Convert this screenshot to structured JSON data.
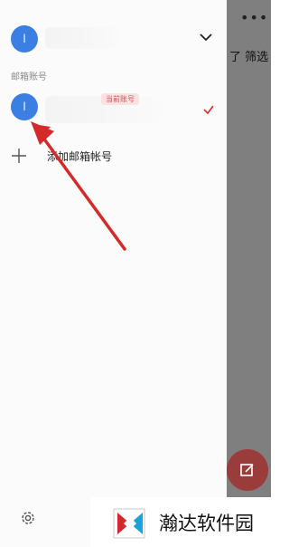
{
  "background_app": {
    "more_glyph": "•••",
    "filter_label": "筛选",
    "filter_icon_glyph": "了"
  },
  "drawer": {
    "current_account": {
      "avatar_letter": "l"
    },
    "section_label": "邮箱账号",
    "accounts": [
      {
        "avatar_letter": "l",
        "badge": "当前账号",
        "checked": true
      }
    ],
    "add_account_label": "添加邮箱帐号"
  },
  "watermark": {
    "text": "瀚达软件园"
  },
  "colors": {
    "accent": "#d32f2f",
    "avatar": "#3c7fe3",
    "annotation_arrow": "#d42a2a"
  }
}
